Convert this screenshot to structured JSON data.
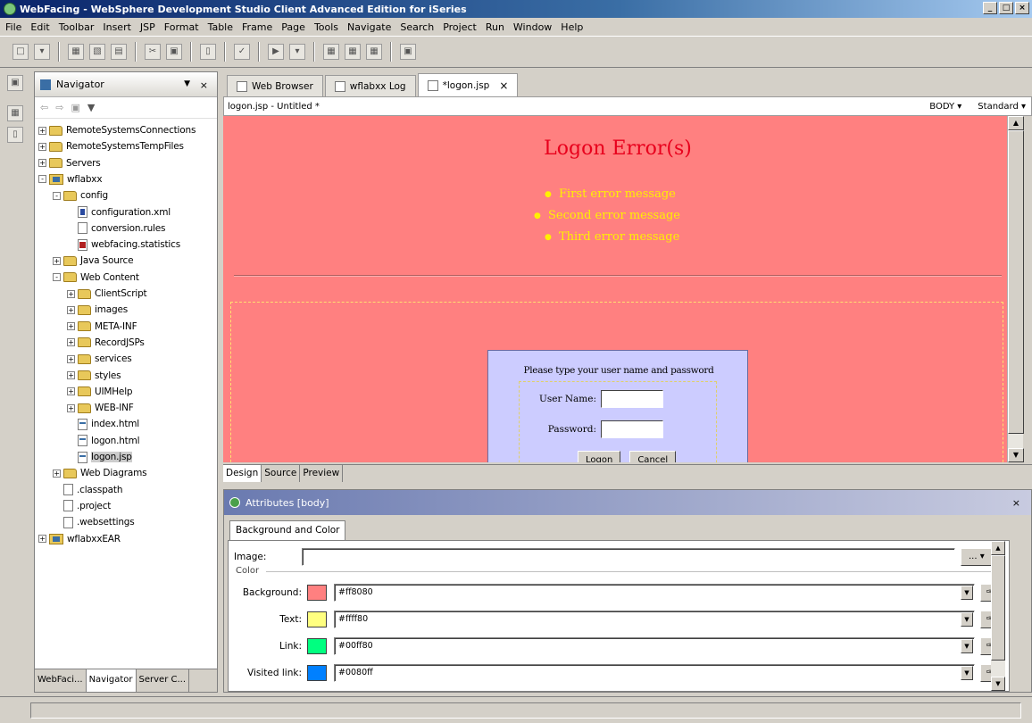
{
  "window": {
    "title": "WebFacing - WebSphere Development Studio Client Advanced Edition for iSeries",
    "controls": [
      "_",
      "□",
      "×"
    ]
  },
  "menu": [
    "File",
    "Edit",
    "Toolbar",
    "Insert",
    "JSP",
    "Format",
    "Table",
    "Frame",
    "Page",
    "Tools",
    "Navigate",
    "Search",
    "Project",
    "Run",
    "Window",
    "Help"
  ],
  "navigator": {
    "title": "Navigator",
    "close": "×",
    "tree": [
      {
        "label": "RemoteSystemsConnections",
        "depth": 0,
        "icon": "folder",
        "exp": "+"
      },
      {
        "label": "RemoteSystemsTempFiles",
        "depth": 0,
        "icon": "folder",
        "exp": "+"
      },
      {
        "label": "Servers",
        "depth": 0,
        "icon": "folder",
        "exp": "+"
      },
      {
        "label": "wflabxx",
        "depth": 0,
        "icon": "project",
        "exp": "-"
      },
      {
        "label": "config",
        "depth": 1,
        "icon": "folder",
        "exp": "-"
      },
      {
        "label": "configuration.xml",
        "depth": 2,
        "icon": "file-x",
        "exp": ""
      },
      {
        "label": "conversion.rules",
        "depth": 2,
        "icon": "file",
        "exp": ""
      },
      {
        "label": "webfacing.statistics",
        "depth": 2,
        "icon": "file-s",
        "exp": ""
      },
      {
        "label": "Java Source",
        "depth": 1,
        "icon": "folder",
        "exp": "+"
      },
      {
        "label": "Web Content",
        "depth": 1,
        "icon": "folder",
        "exp": "-"
      },
      {
        "label": "ClientScript",
        "depth": 2,
        "icon": "folder",
        "exp": "+"
      },
      {
        "label": "images",
        "depth": 2,
        "icon": "folder",
        "exp": "+"
      },
      {
        "label": "META-INF",
        "depth": 2,
        "icon": "folder",
        "exp": "+"
      },
      {
        "label": "RecordJSPs",
        "depth": 2,
        "icon": "folder",
        "exp": "+"
      },
      {
        "label": "services",
        "depth": 2,
        "icon": "folder",
        "exp": "+"
      },
      {
        "label": "styles",
        "depth": 2,
        "icon": "folder",
        "exp": "+"
      },
      {
        "label": "UIMHelp",
        "depth": 2,
        "icon": "folder",
        "exp": "+"
      },
      {
        "label": "WEB-INF",
        "depth": 2,
        "icon": "folder",
        "exp": "+"
      },
      {
        "label": "index.html",
        "depth": 2,
        "icon": "file-j",
        "exp": ""
      },
      {
        "label": "logon.html",
        "depth": 2,
        "icon": "file-j",
        "exp": ""
      },
      {
        "label": "logon.jsp",
        "depth": 2,
        "icon": "file-j",
        "exp": "",
        "selected": true
      },
      {
        "label": "Web Diagrams",
        "depth": 1,
        "icon": "folder",
        "exp": "+"
      },
      {
        "label": ".classpath",
        "depth": 1,
        "icon": "file",
        "exp": ""
      },
      {
        "label": ".project",
        "depth": 1,
        "icon": "file",
        "exp": ""
      },
      {
        "label": ".websettings",
        "depth": 1,
        "icon": "file",
        "exp": ""
      },
      {
        "label": "wflabxxEAR",
        "depth": 0,
        "icon": "project",
        "exp": "+"
      }
    ],
    "tabs": [
      "WebFaci...",
      "Navigator",
      "Server C..."
    ]
  },
  "editor": {
    "tabs": [
      {
        "label": "Web Browser",
        "active": false
      },
      {
        "label": "wflabxx Log",
        "active": false
      },
      {
        "label": "*logon.jsp",
        "active": true,
        "close": "×"
      }
    ],
    "file_label": "logon.jsp - Untitled *",
    "tag_select": "BODY",
    "mode_select": "Standard",
    "page": {
      "title": "Logon Error(s)",
      "errors": [
        "First error message",
        "Second error message",
        "Third error message"
      ],
      "prompt": "Please type your user name and password",
      "username_label": "User Name:",
      "password_label": "Password:",
      "logon_button": "Logon",
      "cancel_button": "Cancel",
      "bg_color": "#ff8080",
      "title_color": "#e8001c",
      "text_color": "#fff000"
    },
    "page_tabs": [
      "Design",
      "Source",
      "Preview"
    ]
  },
  "attributes": {
    "title": "Attributes [body]",
    "close": "×",
    "tab": "Background and Color",
    "image_label": "Image:",
    "image_value": "",
    "image_button": "...",
    "color_group": "Color",
    "rows": [
      {
        "label": "Background:",
        "value": "#ff8080",
        "swatch": "#ff8080"
      },
      {
        "label": "Text:",
        "value": "#ffff80",
        "swatch": "#ffff80"
      },
      {
        "label": "Link:",
        "value": "#00ff80",
        "swatch": "#00ff80"
      },
      {
        "label": "Visited link:",
        "value": "#0080ff",
        "swatch": "#0080ff"
      }
    ]
  }
}
